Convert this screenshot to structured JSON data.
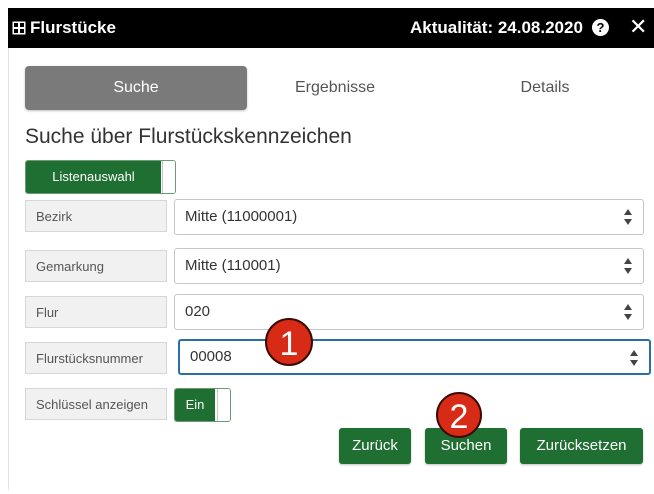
{
  "titlebar": {
    "title": "Flurstücke",
    "actuality": "Aktualität: 24.08.2020",
    "help_glyph": "?",
    "close_glyph": "✕",
    "table_icon": "table-icon"
  },
  "tabs": [
    {
      "label": "Suche",
      "active": true
    },
    {
      "label": "Ergebnisse",
      "active": false
    },
    {
      "label": "Details",
      "active": false
    }
  ],
  "heading": "Suche über Flurstückskennzeichen",
  "toggles": {
    "liste": "Listenauswahl",
    "key_label": "Schlüssel anzeigen",
    "key_value": "Ein"
  },
  "fields": [
    {
      "label": "Bezirk",
      "value": "Mitte (11000001)"
    },
    {
      "label": "Gemarkung",
      "value": "Mitte (110001)"
    },
    {
      "label": "Flur",
      "value": "020"
    },
    {
      "label": "Flurstücksnummer",
      "value": "00008"
    }
  ],
  "buttons": {
    "back": "Zurück",
    "search": "Suchen",
    "reset": "Zurücksetzen"
  },
  "markers": {
    "one": "1",
    "two": "2"
  },
  "colors": {
    "accent": "#1f6e32",
    "tab_active": "#7a7a7a",
    "focus": "#2c6fa6",
    "marker": "#d82b17"
  }
}
